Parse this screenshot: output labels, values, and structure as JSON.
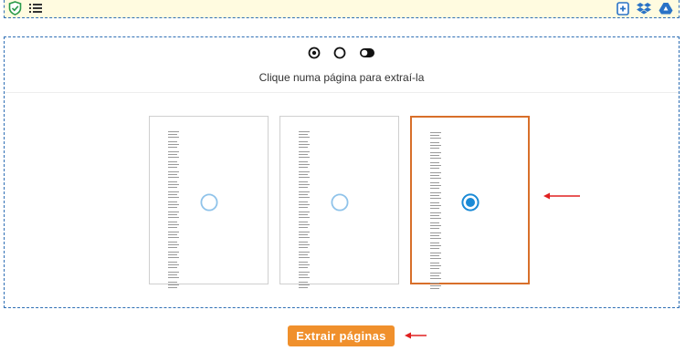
{
  "topbar": {
    "left_icons": [
      "shield-check-icon",
      "list-icon"
    ],
    "right_icons": [
      "add-file-icon",
      "dropbox-icon",
      "google-drive-icon"
    ]
  },
  "modes": {
    "options": [
      "select-single-mode",
      "select-none-mode",
      "toggle-mode"
    ]
  },
  "instruction": "Clique numa página para extraí-la",
  "pages": [
    {
      "selected": false
    },
    {
      "selected": false
    },
    {
      "selected": true
    }
  ],
  "extract_button": "Extrair páginas",
  "colors": {
    "accent": "#f0902c",
    "selected_border": "#d86f2a",
    "radio_blue": "#1a8ad6",
    "radio_light": "#8fc3ea",
    "panel_border": "#2f6fb5",
    "arrow_red": "#e02020"
  }
}
